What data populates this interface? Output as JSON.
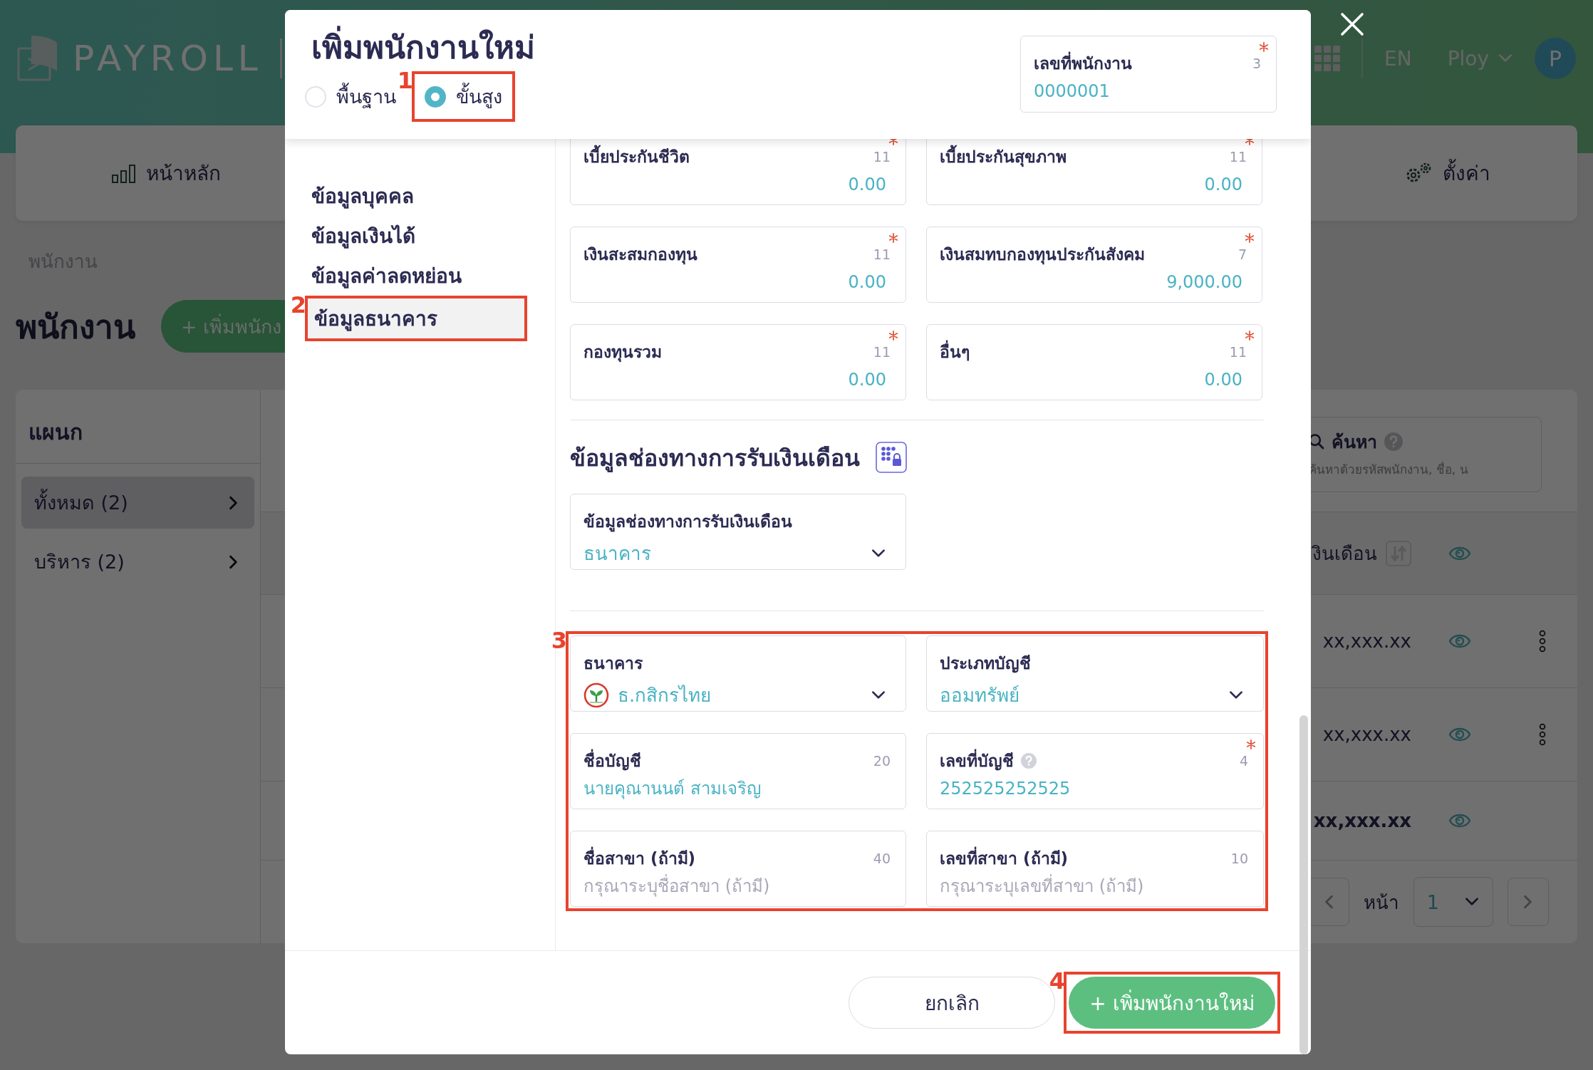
{
  "header": {
    "logo": "PAYROLL",
    "language": "EN",
    "user": "Ploy",
    "avatar": "P"
  },
  "nav": [
    {
      "label": "หน้าหลัก",
      "kind": "dashboard"
    },
    {
      "label": "ตั้งค่า",
      "kind": "settings"
    }
  ],
  "breadcrumb": "พนักงาน",
  "page_title": "พนักงาน",
  "add_button": "+ เพิ่มพนักง",
  "departments": {
    "title": "แผนก",
    "items": [
      {
        "label": "ทั้งหมด (2)",
        "selected": true
      },
      {
        "label": "บริหาร (2)",
        "selected": false
      }
    ]
  },
  "search": {
    "label": "ค้นหา",
    "placeholder": "ค้นหาด้วยรหัสพนักงาน, ชื่อ, น"
  },
  "table": {
    "columns": [
      "งินเดือน"
    ],
    "rows": [
      {
        "salary": "xx,xxx.xx",
        "kind": "employee"
      },
      {
        "salary": "xx,xxx.xx",
        "kind": "employee"
      },
      {
        "salary": "xx,xxx.xx",
        "kind": "total"
      }
    ]
  },
  "pagination": {
    "label": "หน้า",
    "page": "1"
  },
  "modal": {
    "title": "เพิ่มพนักงานใหม่",
    "modes": [
      {
        "label": "พื้นฐาน",
        "selected": false
      },
      {
        "label": "ขั้นสูง",
        "selected": true,
        "callout": "1"
      }
    ],
    "employee_number": {
      "label": "เลขที่พนักงาน",
      "counter": "3",
      "required": true,
      "value": "0000001"
    },
    "sections": [
      {
        "label": "ข้อมูลบุคคล",
        "selected": false
      },
      {
        "label": "ข้อมูลเงินได้",
        "selected": false
      },
      {
        "label": "ข้อมูลค่าลดหย่อน",
        "selected": false
      },
      {
        "label": "ข้อมูลธนาคาร",
        "selected": true,
        "callout": "2"
      }
    ],
    "deduction_fields": [
      {
        "label": "เบี้ยประกันชีวิต",
        "counter": "11",
        "required": true,
        "value": "0.00",
        "kind": "amount"
      },
      {
        "label": "เบี้ยประกันสุขภาพ",
        "counter": "11",
        "required": true,
        "value": "0.00",
        "kind": "amount"
      },
      {
        "label": "เงินสะสมกองทุน",
        "counter": "11",
        "required": true,
        "value": "0.00",
        "kind": "amount"
      },
      {
        "label": "เงินสมทบกองทุนประกันสังคม",
        "counter": "7",
        "required": true,
        "value": "9,000.00",
        "kind": "amount"
      },
      {
        "label": "กองทุนรวม",
        "counter": "11",
        "required": true,
        "value": "0.00",
        "kind": "amount"
      },
      {
        "label": "อื่นๆ",
        "counter": "11",
        "required": true,
        "value": "0.00",
        "kind": "amount"
      }
    ],
    "payment_title": "ข้อมูลช่องทางการรับเงินเดือน",
    "payment_field": {
      "label": "ข้อมูลช่องทางการรับเงินเดือน",
      "required": false,
      "value": "ธนาคาร",
      "kind": "select"
    },
    "bank": {
      "callout": "3",
      "fields": [
        {
          "label": "ธนาคาร",
          "required": false,
          "help": false,
          "value": "ธ.กสิกรไทย",
          "kind": "bank-select"
        },
        {
          "label": "ประเภทบัญชี",
          "required": false,
          "help": false,
          "value": "ออมทรัพย์",
          "kind": "select"
        },
        {
          "label": "ชื่อบัญชี",
          "counter": "20",
          "required": false,
          "help": false,
          "value": "นายคุณานนต์ สามเจริญ",
          "kind": "text"
        },
        {
          "label": "เลขที่บัญชี",
          "counter": "4",
          "required": true,
          "help": true,
          "value": "252525252525",
          "kind": "text"
        },
        {
          "label": "ชื่อสาขา (ถ้ามี)",
          "counter": "40",
          "required": false,
          "help": false,
          "placeholder": "กรุณาระบุชื่อสาขา (ถ้ามี)",
          "kind": "text"
        },
        {
          "label": "เลขที่สาขา (ถ้ามี)",
          "counter": "10",
          "required": false,
          "help": false,
          "placeholder": "กรุณาระบุเลขที่สาขา (ถ้ามี)",
          "kind": "text"
        }
      ]
    },
    "buttons": [
      {
        "label": "ยกเลิก",
        "kind": "cancel"
      },
      {
        "label": "+ เพิ่มพนักงานใหม่",
        "kind": "submit",
        "callout": "4"
      }
    ]
  }
}
